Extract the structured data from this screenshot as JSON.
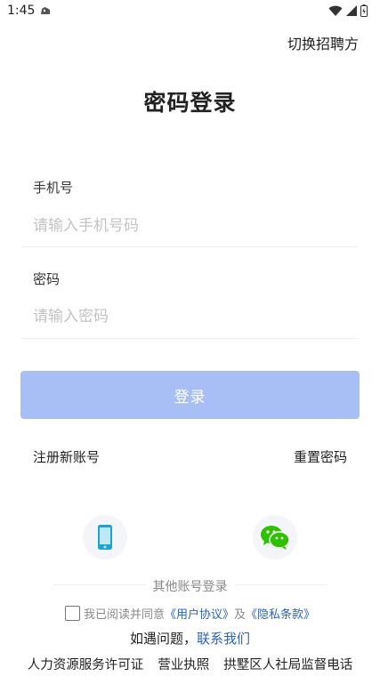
{
  "status_bar": {
    "time": "1:45",
    "app_icon": "notification-app-icon",
    "icons": [
      "wifi-icon",
      "signal-icon",
      "battery-icon"
    ]
  },
  "header": {
    "switch_role": "切换招聘方",
    "title": "密码登录"
  },
  "form": {
    "phone": {
      "label": "手机号",
      "placeholder": "请输入手机号码",
      "value": ""
    },
    "password": {
      "label": "密码",
      "placeholder": "请输入密码",
      "value": ""
    },
    "login_button": "登录"
  },
  "links": {
    "register": "注册新账号",
    "reset_password": "重置密码"
  },
  "other_login": {
    "label": "其他账号登录",
    "options": [
      {
        "icon": "phone-icon",
        "color": "#1aa3d6"
      },
      {
        "icon": "wechat-icon",
        "color": "#2dc100"
      }
    ]
  },
  "agreement": {
    "prefix": "我已阅读并同意",
    "user_agreement": "《用户协议》",
    "and": "及",
    "privacy_policy": "《隐私条款》",
    "checked": false
  },
  "help": {
    "prefix": "如遇问题，",
    "contact": "联系我们"
  },
  "footer": {
    "items": [
      "人力资源服务许可证",
      "营业执照",
      "拱墅区人社局监督电话"
    ]
  },
  "colors": {
    "login_button_bg": "#a7bff5",
    "link_blue": "#2a62c9"
  }
}
